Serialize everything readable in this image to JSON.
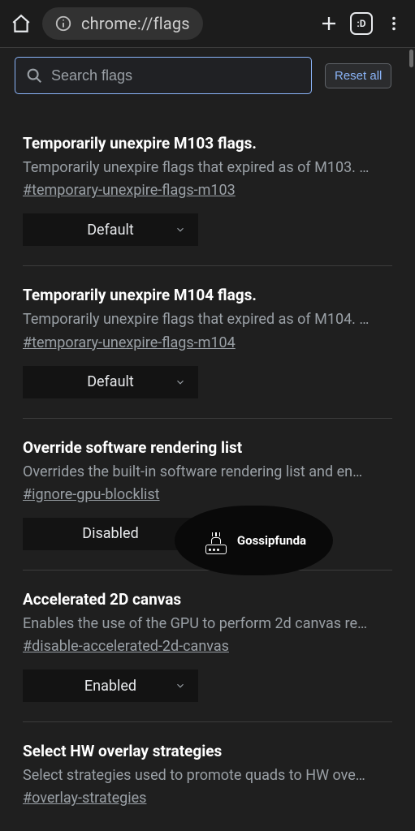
{
  "chrome": {
    "omnibox_text": "chrome://flags",
    "tab_count": ":D"
  },
  "search": {
    "placeholder": "Search flags",
    "reset_label": "Reset all"
  },
  "flags": [
    {
      "title": "Temporarily unexpire M103 flags.",
      "desc": "Temporarily unexpire flags that expired as of M103. …",
      "hash": "#temporary-unexpire-flags-m103",
      "value": "Default"
    },
    {
      "title": "Temporarily unexpire M104 flags.",
      "desc": "Temporarily unexpire flags that expired as of M104. …",
      "hash": "#temporary-unexpire-flags-m104",
      "value": "Default"
    },
    {
      "title": "Override software rendering list",
      "desc": "Overrides the built-in software rendering list and en…",
      "hash": "#ignore-gpu-blocklist",
      "value": "Disabled"
    },
    {
      "title": "Accelerated 2D canvas",
      "desc": "Enables the use of the GPU to perform 2d canvas re…",
      "hash": "#disable-accelerated-2d-canvas",
      "value": "Enabled"
    },
    {
      "title": "Select HW overlay strategies",
      "desc": "Select strategies used to promote quads to HW ove…",
      "hash": "#overlay-strategies",
      "value": ""
    }
  ],
  "watermark": {
    "label": "Gossipfunda"
  }
}
